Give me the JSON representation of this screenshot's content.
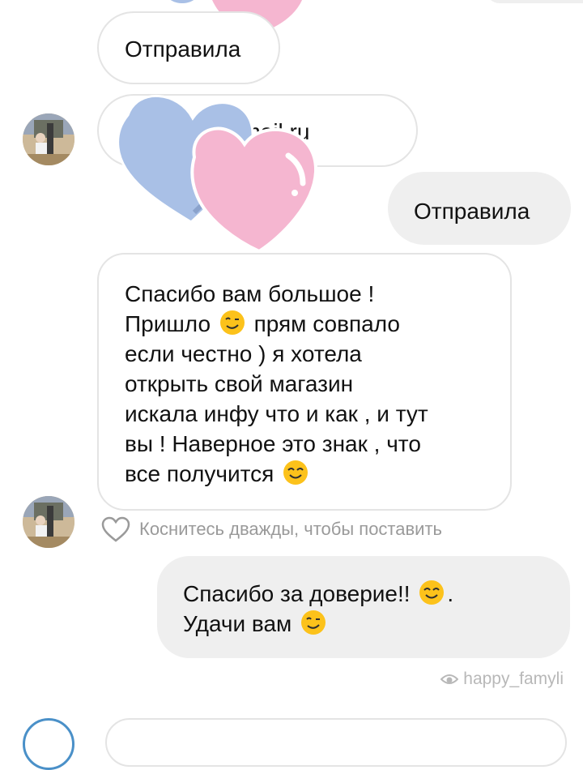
{
  "chat": {
    "messages": [
      {
        "text": "Отправила"
      },
      {
        "text": "mail.ru"
      },
      {
        "text": "Отправила"
      },
      {
        "lines": [
          "Спасибо вам большое  !",
          "Пришло",
          "прям совпало",
          "если честно ) я хотела",
          "открыть свой магазин",
          "искала инфу что и как , и тут",
          "вы ! Наверное это знак , что",
          "все получится"
        ]
      },
      {
        "lines": [
          "Спасибо за доверие!!",
          ".",
          "Удачи вам"
        ]
      }
    ],
    "email_fragment": "@",
    "like_hint": "Коснитесь дважды, чтобы поставить",
    "watermark": "happy_famyli"
  },
  "icons": {
    "like": "heart-outline-icon",
    "wink": "winking-face-emoji",
    "smile": "smiling-face-emoji"
  },
  "colors": {
    "heart_blue": "#a9c0e6",
    "heart_pink": "#f5b6d0",
    "outgoing_bubble": "#efefef",
    "incoming_border": "#e4e4e4"
  }
}
